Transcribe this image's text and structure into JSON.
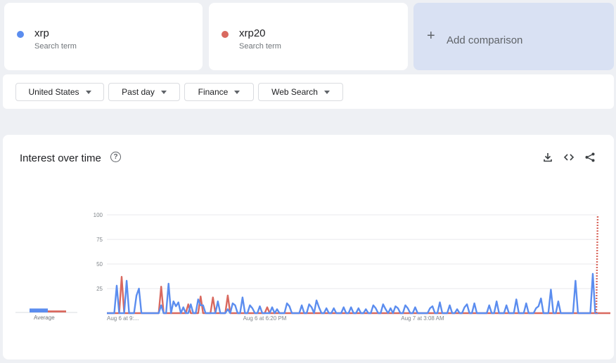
{
  "terms": [
    {
      "name": "xrp",
      "subtitle": "Search term",
      "color": "#5b8def"
    },
    {
      "name": "xrp20",
      "subtitle": "Search term",
      "color": "#d9695f"
    }
  ],
  "add_comparison": {
    "icon": "plus-icon",
    "label": "Add comparison"
  },
  "filters": {
    "region": "United States",
    "time_range": "Past day",
    "category": "Finance",
    "property": "Web Search"
  },
  "chart_section": {
    "title": "Interest over time",
    "help_icon_glyph": "?",
    "actions": [
      "download-icon",
      "embed-icon",
      "share-icon"
    ],
    "average_label": "Average"
  },
  "chart_data": {
    "type": "line",
    "ylim": [
      0,
      100
    ],
    "yticks": [
      25,
      50,
      75,
      100
    ],
    "x_tick_labels": [
      "Aug 6 at 9:...",
      "Aug 6 at 6:20 PM",
      "Aug 7 at 3:08 AM"
    ],
    "x_tick_indices": [
      0,
      64,
      128
    ],
    "grid": true,
    "averages": [
      {
        "name": "xrp",
        "value": 4
      },
      {
        "name": "xrp20",
        "value": 2
      }
    ],
    "series": [
      {
        "name": "xrp",
        "color": "#5b8def",
        "values": [
          0,
          0,
          0,
          0,
          28,
          0,
          0,
          0,
          33,
          0,
          0,
          0,
          18,
          25,
          0,
          0,
          0,
          0,
          0,
          0,
          0,
          0,
          8,
          0,
          0,
          30,
          0,
          12,
          7,
          11,
          0,
          6,
          0,
          0,
          9,
          0,
          0,
          14,
          8,
          8,
          0,
          0,
          0,
          0,
          0,
          12,
          0,
          0,
          0,
          4,
          0,
          10,
          8,
          0,
          0,
          16,
          0,
          0,
          8,
          5,
          0,
          0,
          7,
          0,
          0,
          0,
          0,
          6,
          0,
          4,
          0,
          0,
          0,
          10,
          7,
          0,
          0,
          0,
          0,
          8,
          0,
          0,
          9,
          6,
          0,
          13,
          6,
          0,
          0,
          5,
          0,
          0,
          5,
          0,
          0,
          0,
          6,
          0,
          0,
          6,
          0,
          0,
          5,
          0,
          0,
          4,
          0,
          0,
          8,
          5,
          0,
          0,
          9,
          4,
          0,
          5,
          0,
          7,
          5,
          0,
          0,
          8,
          5,
          0,
          0,
          6,
          0,
          0,
          0,
          0,
          0,
          5,
          7,
          0,
          0,
          11,
          0,
          0,
          0,
          8,
          0,
          0,
          4,
          0,
          0,
          6,
          9,
          0,
          0,
          10,
          0,
          0,
          0,
          0,
          0,
          8,
          0,
          0,
          12,
          0,
          0,
          0,
          8,
          0,
          0,
          0,
          14,
          0,
          0,
          0,
          10,
          0,
          0,
          0,
          5,
          7,
          15,
          0,
          0,
          0,
          24,
          0,
          0,
          12,
          0,
          0,
          0,
          0,
          0,
          0,
          33,
          0,
          0,
          0,
          0,
          0,
          0,
          40,
          0,
          0
        ]
      },
      {
        "name": "xrp20",
        "color": "#d9695f",
        "values": [
          0,
          0,
          0,
          0,
          0,
          0,
          37,
          0,
          0,
          0,
          0,
          0,
          0,
          0,
          0,
          0,
          0,
          0,
          0,
          0,
          0,
          0,
          27,
          0,
          0,
          0,
          0,
          0,
          0,
          0,
          0,
          0,
          0,
          9,
          0,
          0,
          0,
          0,
          17,
          0,
          0,
          0,
          0,
          16,
          0,
          0,
          0,
          0,
          0,
          18,
          0,
          0,
          0,
          0,
          0,
          0,
          0,
          0,
          0,
          0,
          0,
          0,
          0,
          0,
          0,
          6,
          0,
          0,
          0,
          0,
          0,
          0,
          0,
          0,
          0,
          0,
          0,
          0,
          0,
          0,
          0,
          0,
          0,
          0,
          0,
          0,
          0,
          0,
          0,
          0,
          0,
          0,
          0,
          0,
          0,
          0,
          0,
          0,
          0,
          0,
          0,
          0,
          0,
          0,
          0,
          0,
          0,
          0,
          0,
          0,
          0,
          0,
          0,
          0,
          0,
          0,
          0,
          0,
          0,
          0,
          0,
          0,
          0,
          0,
          0,
          0,
          0,
          0,
          0,
          0,
          0,
          0,
          0,
          0,
          0,
          0,
          0,
          0,
          0,
          0,
          0,
          0,
          0,
          0,
          0,
          0,
          0,
          0,
          0,
          0,
          0,
          0,
          0,
          0,
          0,
          0,
          0,
          0,
          0,
          0,
          0,
          0,
          0,
          0,
          0,
          0,
          0,
          0,
          0,
          0,
          0,
          0,
          0,
          0,
          0,
          0,
          0,
          0,
          0,
          0,
          0,
          0,
          0,
          0,
          0,
          0,
          0,
          0,
          0,
          0,
          0,
          0,
          0,
          0,
          0,
          0,
          0,
          0,
          0,
          0,
          0,
          0,
          0,
          0,
          0,
          0,
          0,
          0,
          0,
          0,
          0
        ]
      },
      {
        "name": "xrp20",
        "color": "#d9695f",
        "values": [
          0,
          0,
          0,
          0,
          0,
          0,
          0,
          0,
          0,
          0,
          0,
          0,
          0,
          0,
          0,
          0,
          0,
          0,
          0,
          0,
          0,
          0,
          0,
          0,
          0,
          0,
          0,
          0,
          0,
          0,
          0,
          0,
          0,
          0,
          0,
          0,
          0,
          0,
          0,
          0,
          0,
          0,
          0,
          0,
          0,
          0,
          0,
          0,
          0,
          0,
          0,
          0,
          0,
          0,
          0,
          0,
          0,
          0,
          0,
          0,
          0,
          0,
          0,
          0,
          0,
          0,
          0,
          0,
          0,
          0,
          0,
          0,
          0,
          0,
          0,
          0,
          0,
          0,
          0,
          0,
          0,
          0,
          0,
          0,
          0,
          0,
          0,
          0,
          0,
          0,
          0,
          0,
          0,
          0,
          0,
          0,
          0,
          0,
          0,
          0,
          0,
          0,
          0,
          0,
          0,
          0,
          0,
          0,
          0,
          0,
          0,
          0,
          0,
          0,
          0,
          0,
          0,
          0,
          0,
          0,
          0,
          0,
          0,
          0,
          0,
          0,
          0,
          0,
          0,
          0,
          0,
          0,
          0,
          0,
          0,
          0,
          0,
          0,
          0,
          0,
          0,
          0,
          0,
          0,
          0,
          0,
          0,
          0,
          0,
          0,
          0,
          0,
          0,
          0,
          0,
          0,
          0,
          0,
          0,
          0,
          0,
          0,
          0,
          0,
          0,
          0,
          0,
          0,
          0,
          0,
          0,
          0,
          0,
          0,
          0,
          0,
          0,
          0,
          0,
          0,
          0,
          0,
          0,
          0,
          0,
          0,
          0,
          0,
          0,
          0,
          0,
          0,
          0,
          0,
          0,
          0,
          0,
          0,
          0,
          0,
          0,
          0,
          0,
          0,
          0,
          0,
          0,
          0,
          0,
          0,
          0
        ]
      }
    ],
    "partial_data": {
      "name": "xrp20",
      "last_value": 100,
      "style": "dotted"
    }
  }
}
